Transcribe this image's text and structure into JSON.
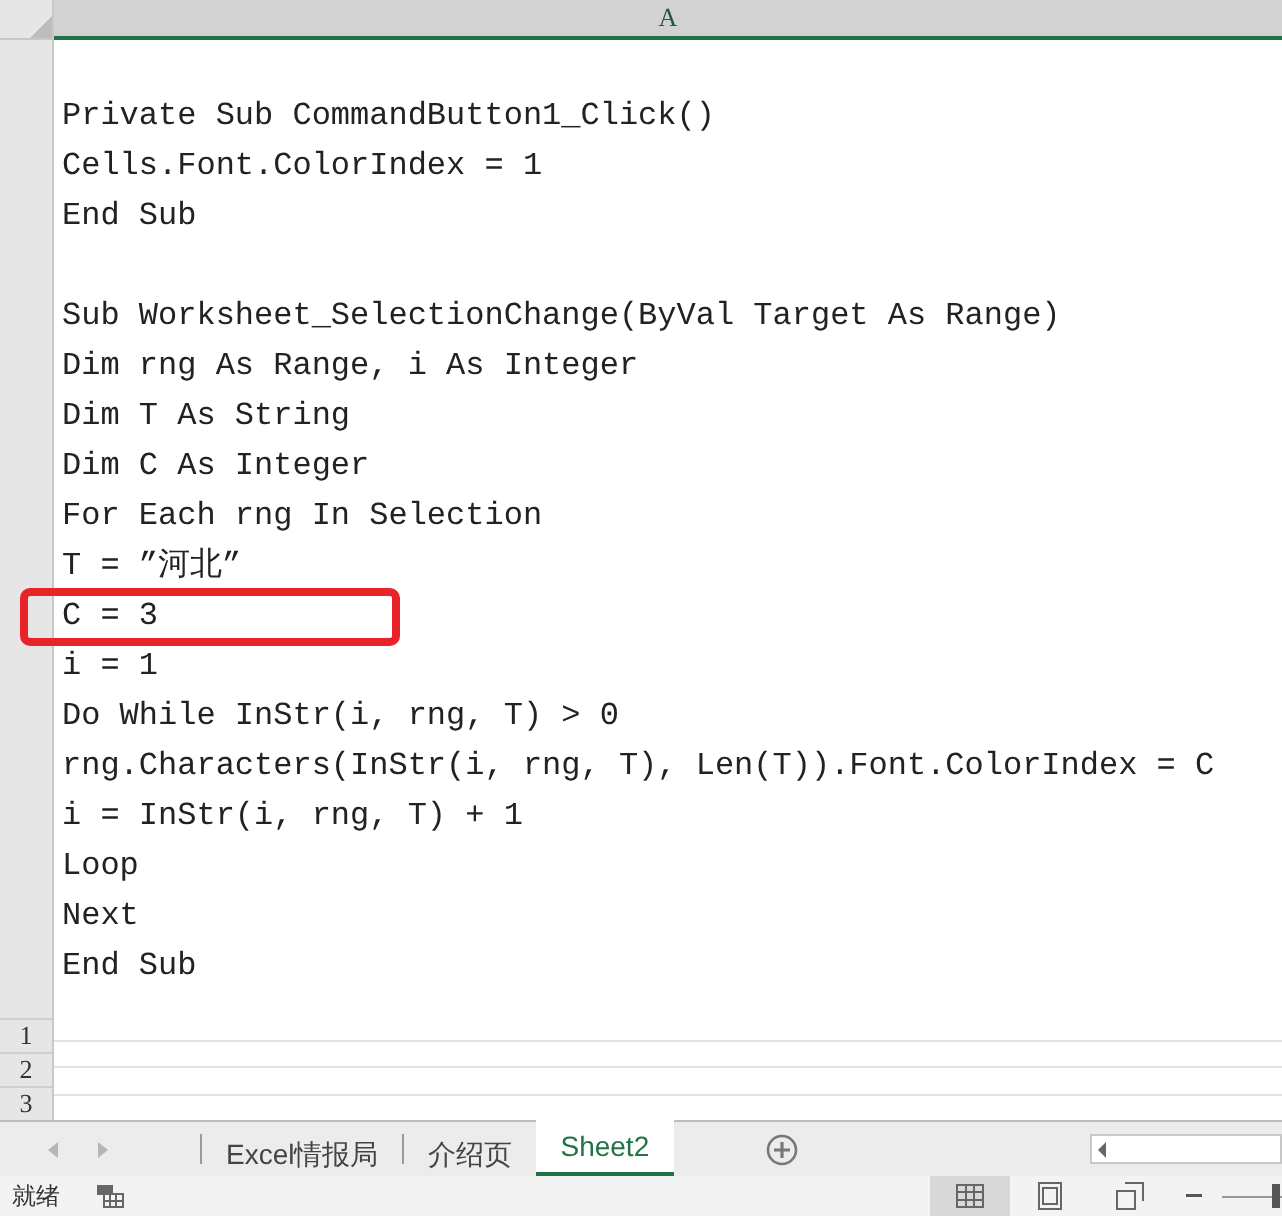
{
  "column_header": "A",
  "code_blocks": [
    {
      "lines": [
        {
          "text": "Private Sub CommandButton1_Click()",
          "highlighted": false
        },
        {
          "text": "Cells.Font.ColorIndex = 1",
          "highlighted": false
        },
        {
          "text": "End Sub",
          "highlighted": false
        }
      ]
    },
    {
      "lines": [
        {
          "text": "Sub Worksheet_SelectionChange(ByVal Target As Range)",
          "highlighted": false
        },
        {
          "text": "Dim rng As Range, i As Integer",
          "highlighted": false
        },
        {
          "text": "Dim T As String",
          "highlighted": false
        },
        {
          "text": "Dim C As Integer",
          "highlighted": false
        },
        {
          "text": "For Each rng In Selection",
          "highlighted": false
        },
        {
          "text": "T = ”河北”",
          "highlighted": false
        },
        {
          "text": "C = 3",
          "highlighted": true
        },
        {
          "text": "i = 1",
          "highlighted": false
        },
        {
          "text": "Do While InStr(i, rng, T) > 0",
          "highlighted": false
        },
        {
          "text": "rng.Characters(InStr(i, rng, T), Len(T)).Font.ColorIndex = C",
          "highlighted": false
        },
        {
          "text": "i = InStr(i, rng, T) + 1",
          "highlighted": false
        },
        {
          "text": "Loop",
          "highlighted": false
        },
        {
          "text": "Next",
          "highlighted": false
        },
        {
          "text": "End Sub",
          "highlighted": false
        }
      ]
    }
  ],
  "row_numbers": [
    "1",
    "2",
    "3"
  ],
  "sheet_tabs": [
    {
      "label": "Excel情报局",
      "selected": false
    },
    {
      "label": "介绍页",
      "selected": false
    },
    {
      "label": "Sheet2",
      "selected": true
    }
  ],
  "status_bar": {
    "text": "就绪",
    "zoom": {
      "level": 0.9
    }
  }
}
